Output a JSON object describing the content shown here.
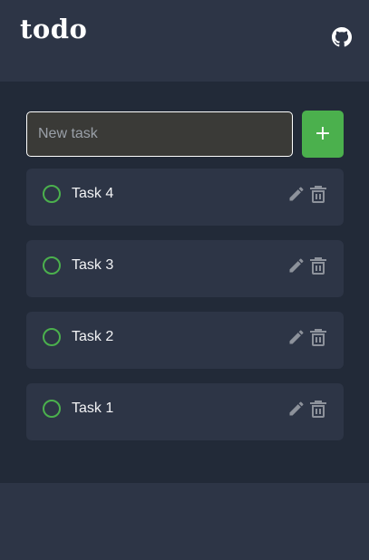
{
  "app": {
    "title": "todo",
    "github_icon": "github-icon"
  },
  "new_task": {
    "placeholder": "New task",
    "value": "",
    "add_label": "+"
  },
  "tasks": [
    {
      "label": "Task 4",
      "completed": false
    },
    {
      "label": "Task 3",
      "completed": false
    },
    {
      "label": "Task 2",
      "completed": false
    },
    {
      "label": "Task 1",
      "completed": false
    }
  ],
  "icons": {
    "check": "circle-outline-icon",
    "edit": "pencil-icon",
    "delete": "trash-icon"
  },
  "colors": {
    "background": "#2d3546",
    "panel": "#222a38",
    "card": "#2d3546",
    "accent": "#4bb04d",
    "icon": "#8d929b"
  }
}
